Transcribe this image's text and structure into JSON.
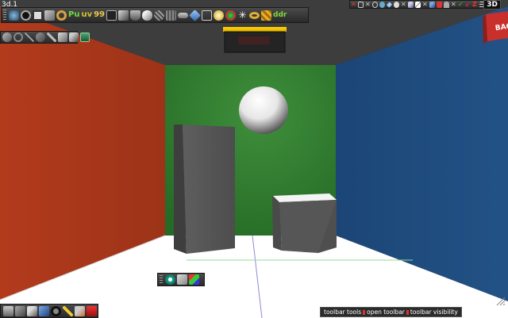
{
  "window": {
    "title": "3d.1",
    "mode_badge": "3D"
  },
  "top_toolbar": {
    "icons": [
      "camera-icon",
      "lookat-icon",
      "select-icon",
      "arrow-icon",
      "torus-icon",
      "pu-icon",
      "uv-icon",
      "nine-nine-icon",
      "film-icon",
      "cube-icon",
      "cup-icon",
      "brush-icon",
      "sphere-icon",
      "texture-icon",
      "tube-icon",
      "gem-icon",
      "square-icon",
      "bulb-icon",
      "earth-icon",
      "star-icon",
      "ring-icon",
      "grid-icon",
      "ddr-icon"
    ],
    "labels": {
      "pu": "Pu",
      "uv": "uv",
      "nine": "99",
      "ddr": "ddr"
    }
  },
  "right_toolbar": {
    "icons": [
      "x-axis-icon",
      "coord-icon",
      "x2-icon",
      "link-icon",
      "globe-icon",
      "diamond-icon",
      "nodes-icon",
      "x3-icon",
      "pen-icon",
      "diag-icon",
      "x4-icon",
      "pencil-icon",
      "red-tool-icon",
      "lock-icon",
      "x5-icon",
      "check-icon",
      "arrow-red-icon",
      "z-icon",
      "menu-icon"
    ]
  },
  "viewport": {
    "view_cube_label": "BACK",
    "lights_overlay": ""
  },
  "left_toolbar": {
    "icons": [
      "hand-icon",
      "ring2-icon",
      "axis-icon",
      "rotate-icon",
      "scale-icon",
      "pivot-icon",
      "tools-icon",
      "screen-icon"
    ]
  },
  "mid_toolbar": {
    "icons": [
      "eye-icon",
      "shape-icon",
      "rgb-cube-icon"
    ]
  },
  "bottom_toolbar": {
    "icons": [
      "display-icon",
      "paint-icon",
      "edit-icon",
      "wire-icon",
      "ring3-icon",
      "wand-icon",
      "hammer-icon",
      "toolbox-icon"
    ]
  },
  "status_bar": {
    "item1": "toolbar tools",
    "item2": "open toolbar",
    "item3": "toolbar visibility"
  },
  "colors": {
    "left_wall": "#a8361c",
    "right_wall": "#1e4c7c",
    "back_wall": "#2f7f2f",
    "floor": "#ffffff",
    "ceiling": "#3b3b3b"
  }
}
